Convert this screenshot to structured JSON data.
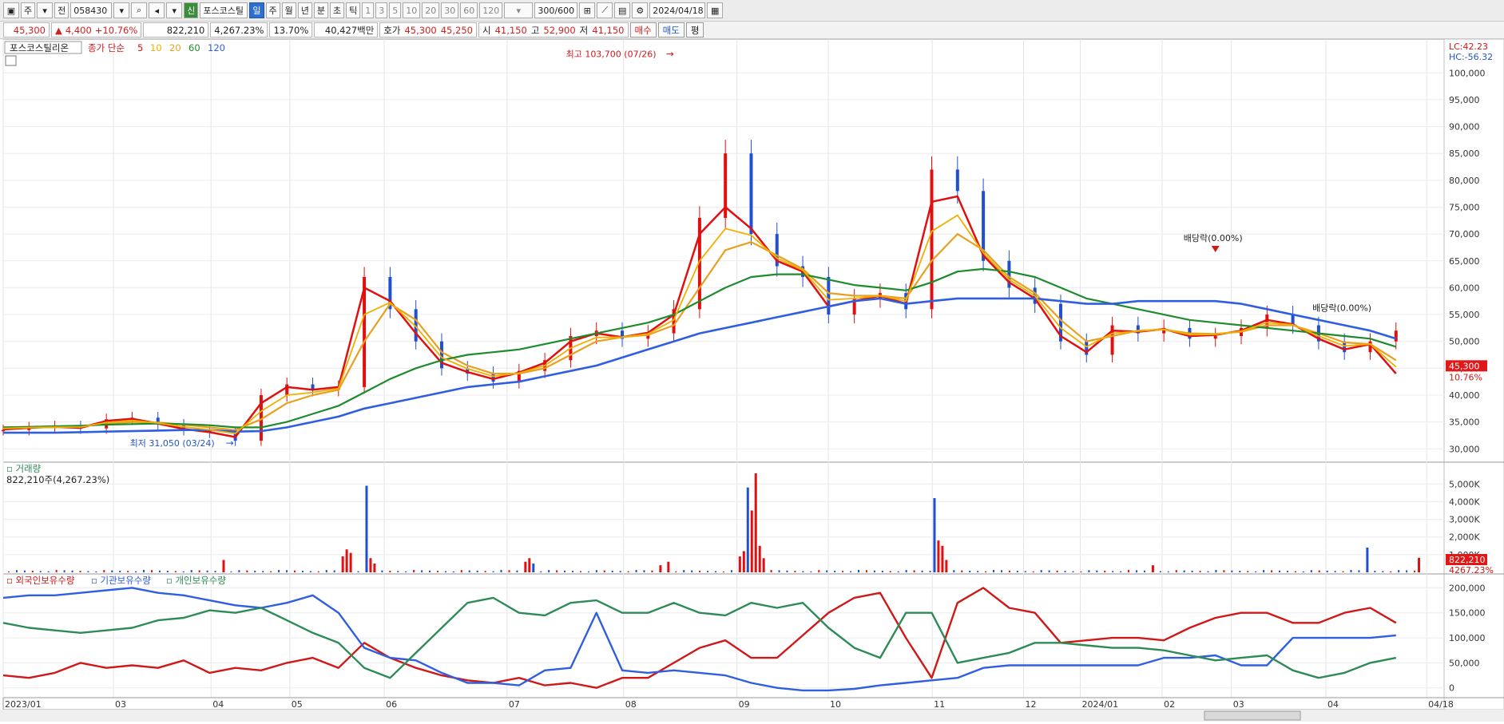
{
  "toolbar": {
    "period_mode": "주",
    "prev_label": "전",
    "code": "058430",
    "name_badge": "신",
    "stock_name": "포스코스틸",
    "periods": [
      "일",
      "주",
      "월",
      "년",
      "분",
      "초",
      "틱"
    ],
    "selected_period": "일",
    "intervals": [
      "1",
      "3",
      "5",
      "10",
      "20",
      "30",
      "60",
      "120"
    ],
    "count": "300/600",
    "date": "2024/04/18"
  },
  "quote": {
    "price": "45,300",
    "change_arrow": "▲",
    "change": "4,400",
    "change_pct": "+10.76%",
    "volume": "822,210",
    "volume_pct": "4,267.23%",
    "turnover": "13.70%",
    "amount": "40,427백만",
    "ask_label": "호가",
    "ask": "45,300",
    "bid": "45,250",
    "open_label": "시",
    "open": "41,150",
    "high_label": "고",
    "high": "52,900",
    "low_label": "저",
    "low": "41,150",
    "buy_button": "매수",
    "sell_button": "매도",
    "eval_button": "평"
  },
  "price_panel": {
    "tab_label": "포스코스틸리온",
    "legend_prefix": "종가 단순",
    "ma_labels": [
      "5",
      "10",
      "20",
      "60",
      "120"
    ],
    "ma_colors": [
      "#e01010",
      "#f0b000",
      "#e8a020",
      "#1e8c2e",
      "#2f5fe0"
    ],
    "lc": "LC:42.23",
    "hc": "HC:-56.32",
    "max_annotation": "최고 103,700 (07/26)",
    "min_annotation": "최저 31,050 (03/24)",
    "ex_div_1": "배당락(0.00%)",
    "ex_div_2": "배당락(0.00%)",
    "last_price_tag": "45,300",
    "last_pct_tag": "10.76%"
  },
  "volume_panel": {
    "tab_label": "거래량",
    "info": "822,210주(4,267.23%)",
    "last_volume_tag": "822,210",
    "last_pct_tag": "4267.23%"
  },
  "holdings_panel": {
    "legend": [
      "외국인보유수량",
      "기관보유수량",
      "개인보유수량"
    ],
    "legend_colors": [
      "#d01818",
      "#2f5fe0",
      "#2e8b57"
    ]
  },
  "chart_data": [
    {
      "type": "line",
      "title": "포스코스틸리온 daily price with moving averages (종가 단순 5/10/20/60/120)",
      "x_ticks": [
        "2023/01",
        "03",
        "04",
        "05",
        "06",
        "07",
        "08",
        "09",
        "10",
        "11",
        "12",
        "2024/01",
        "02",
        "03",
        "04",
        "04/18"
      ],
      "y_ticks": [
        "30,000",
        "35,000",
        "40,000",
        "45,000",
        "50,000",
        "55,000",
        "60,000",
        "65,000",
        "70,000",
        "75,000",
        "80,000",
        "85,000",
        "90,000",
        "95,000",
        "100,000"
      ],
      "ylim": [
        29000,
        104500
      ],
      "x": [
        0,
        6,
        12,
        18,
        24,
        30,
        36,
        42,
        48,
        54,
        60,
        66,
        72,
        78,
        84,
        90,
        96,
        102,
        108,
        114,
        120,
        126,
        132,
        138,
        144,
        150,
        156,
        162,
        168,
        174,
        180,
        186,
        192,
        198,
        204,
        210,
        216,
        222,
        228,
        234,
        240,
        246,
        252,
        258,
        264,
        270,
        276,
        282,
        288,
        294,
        300,
        306,
        312,
        318,
        324
      ],
      "series": [
        {
          "name": "종가",
          "values": [
            33500,
            34000,
            34200,
            33800,
            35500,
            35800,
            34500,
            33500,
            33000,
            31500,
            40000,
            42000,
            41000,
            41500,
            62000,
            56000,
            50000,
            45000,
            44000,
            42500,
            44500,
            46500,
            51000,
            52000,
            50500,
            51500,
            56000,
            73000,
            85000,
            70000,
            64000,
            62000,
            55000,
            58000,
            59000,
            56000,
            82000,
            78000,
            65000,
            60000,
            57000,
            50000,
            47500,
            53000,
            51500,
            52500,
            50500,
            51000,
            52500,
            55000,
            53000,
            50000,
            48000,
            50000,
            52000
          ]
        },
        {
          "name": "MA5",
          "values": [
            33600,
            33900,
            34100,
            33900,
            35200,
            35600,
            34700,
            33700,
            33100,
            32200,
            38500,
            41500,
            41000,
            41500,
            60000,
            57500,
            51500,
            46000,
            44300,
            43000,
            44200,
            46000,
            50000,
            51500,
            50800,
            51600,
            55000,
            70000,
            75000,
            71000,
            65000,
            63000,
            56500,
            57500,
            58500,
            57000,
            76000,
            77000,
            66000,
            61000,
            58000,
            51000,
            48000,
            52000,
            51800,
            52300,
            51000,
            51200,
            52000,
            54000,
            53200,
            50500,
            48500,
            49500,
            44000
          ]
        },
        {
          "name": "MA20",
          "values": [
            34000,
            34000,
            34000,
            34200,
            34600,
            35000,
            34900,
            34500,
            34000,
            33500,
            35500,
            38500,
            40000,
            41000,
            50000,
            57000,
            54000,
            48000,
            45500,
            44000,
            44000,
            45000,
            47500,
            50000,
            50800,
            51200,
            53000,
            60000,
            67000,
            68500,
            66000,
            63500,
            59000,
            58500,
            58500,
            58000,
            65000,
            70000,
            67000,
            62000,
            59000,
            54000,
            50000,
            51000,
            52000,
            52200,
            51500,
            51400,
            51800,
            53000,
            53000,
            51500,
            49800,
            49500,
            46500
          ]
        },
        {
          "name": "MA60",
          "values": [
            34000,
            34100,
            34200,
            34300,
            34500,
            34600,
            34700,
            34600,
            34400,
            34000,
            34000,
            35000,
            36500,
            38000,
            40500,
            43000,
            45000,
            46500,
            47500,
            48000,
            48500,
            49500,
            50500,
            51500,
            52500,
            53500,
            55000,
            57500,
            60000,
            62000,
            62500,
            62500,
            61500,
            60500,
            60000,
            59500,
            61000,
            63000,
            63500,
            63000,
            62000,
            60000,
            58000,
            57000,
            56000,
            55000,
            54000,
            53500,
            53000,
            52500,
            52000,
            51500,
            51000,
            50500,
            49000
          ]
        },
        {
          "name": "MA120",
          "values": [
            33000,
            33000,
            33000,
            33100,
            33200,
            33300,
            33400,
            33500,
            33500,
            33200,
            33300,
            34000,
            35000,
            36000,
            37500,
            38500,
            39500,
            40500,
            41500,
            42000,
            42500,
            43500,
            44500,
            45500,
            47000,
            48500,
            50000,
            51500,
            52500,
            53500,
            54500,
            55500,
            56500,
            57500,
            58000,
            57000,
            57500,
            58000,
            58000,
            58000,
            58000,
            57500,
            57000,
            57000,
            57500,
            57500,
            57500,
            57500,
            57000,
            56000,
            55000,
            54000,
            53000,
            52000,
            50500
          ]
        }
      ]
    },
    {
      "type": "bar",
      "title": "거래량",
      "y_ticks": [
        "1,000K",
        "2,000K",
        "3,000K",
        "4,000K",
        "5,000K"
      ],
      "ylim": [
        0,
        5600
      ],
      "spike_days": [
        54,
        84,
        85,
        86,
        90,
        91,
        92,
        130,
        131,
        132,
        164,
        166,
        184,
        185,
        186,
        187,
        188,
        189,
        190,
        233,
        234,
        235,
        236,
        288,
        342,
        355
      ],
      "spike_values": [
        700,
        900,
        1300,
        1100,
        4900,
        800,
        500,
        600,
        800,
        500,
        400,
        600,
        900,
        1200,
        4800,
        3500,
        5600,
        1500,
        800,
        4200,
        1800,
        1500,
        700,
        400,
        1400,
        822
      ]
    },
    {
      "type": "line",
      "title": "보유수량",
      "y_ticks": [
        "0",
        "50,000",
        "100,000",
        "150,000",
        "200,000"
      ],
      "ylim": [
        -10000,
        215000
      ],
      "series": [
        {
          "name": "외국인보유수량",
          "values": [
            25000,
            20000,
            30000,
            50000,
            40000,
            45000,
            40000,
            55000,
            30000,
            40000,
            35000,
            50000,
            60000,
            40000,
            90000,
            60000,
            40000,
            25000,
            15000,
            10000,
            20000,
            5000,
            10000,
            0,
            20000,
            20000,
            50000,
            80000,
            95000,
            60000,
            60000,
            105000,
            150000,
            180000,
            190000,
            100000,
            20000,
            170000,
            200000,
            160000,
            150000,
            90000,
            95000,
            100000,
            100000,
            95000,
            120000,
            140000,
            150000,
            150000,
            130000,
            130000,
            150000,
            160000,
            130000
          ]
        },
        {
          "name": "기관보유수량",
          "values": [
            180000,
            185000,
            185000,
            190000,
            195000,
            200000,
            190000,
            185000,
            175000,
            165000,
            160000,
            170000,
            185000,
            150000,
            80000,
            60000,
            55000,
            30000,
            10000,
            10000,
            5000,
            35000,
            40000,
            150000,
            35000,
            30000,
            35000,
            30000,
            25000,
            10000,
            0,
            -5000,
            -5000,
            -2000,
            5000,
            10000,
            15000,
            20000,
            40000,
            45000,
            45000,
            45000,
            45000,
            45000,
            45000,
            60000,
            60000,
            65000,
            45000,
            45000,
            100000,
            100000,
            100000,
            100000,
            105000
          ]
        },
        {
          "name": "개인보유수량",
          "values": [
            130000,
            120000,
            115000,
            110000,
            115000,
            120000,
            135000,
            140000,
            155000,
            150000,
            160000,
            135000,
            110000,
            90000,
            40000,
            20000,
            70000,
            120000,
            170000,
            180000,
            150000,
            145000,
            170000,
            175000,
            150000,
            150000,
            170000,
            150000,
            145000,
            170000,
            160000,
            170000,
            120000,
            80000,
            60000,
            150000,
            150000,
            50000,
            60000,
            70000,
            90000,
            90000,
            85000,
            80000,
            80000,
            75000,
            65000,
            55000,
            60000,
            65000,
            35000,
            20000,
            30000,
            50000,
            60000
          ]
        }
      ]
    }
  ]
}
